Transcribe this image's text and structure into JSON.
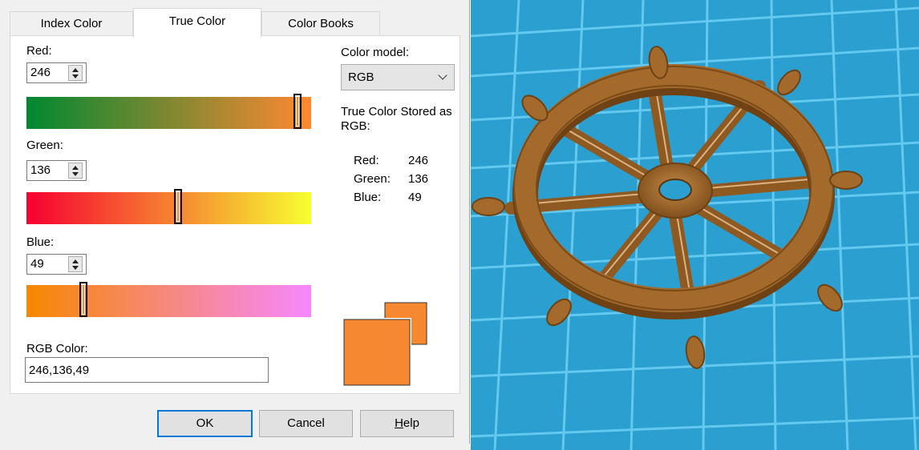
{
  "tabs": [
    {
      "label": "Index Color",
      "active": false
    },
    {
      "label": "True Color",
      "active": true
    },
    {
      "label": "Color Books",
      "active": false
    }
  ],
  "red": {
    "label": "Red:",
    "value": "246",
    "level": 0.965
  },
  "green": {
    "label": "Green:",
    "value": "136",
    "level": 0.533
  },
  "blue": {
    "label": "Blue:",
    "value": "49",
    "level": 0.192
  },
  "color_model": {
    "label": "Color model:",
    "selected": "RGB"
  },
  "stored": {
    "heading": "True Color Stored as RGB:",
    "rows": [
      {
        "label": "Red:",
        "value": "246"
      },
      {
        "label": "Green:",
        "value": "136"
      },
      {
        "label": "Blue:",
        "value": "49"
      }
    ]
  },
  "rgb_color": {
    "label": "RGB Color:",
    "value": "246,136,49"
  },
  "buttons": {
    "ok": "OK",
    "cancel": "Cancel",
    "help": "Help"
  },
  "colors": {
    "current": "#f68831",
    "previous": "#f68831",
    "red_gradient": [
      "#008831",
      "#ff8831"
    ],
    "green_gradient": [
      "#f60031",
      "#f6ff31"
    ],
    "blue_gradient": [
      "#f68800",
      "#f688ff"
    ],
    "grid_background": "#2a9fd0",
    "grid_lines": "#6ccdf2",
    "wheel": "#a46a2c"
  },
  "viewport": {
    "object": "ship-wheel"
  }
}
